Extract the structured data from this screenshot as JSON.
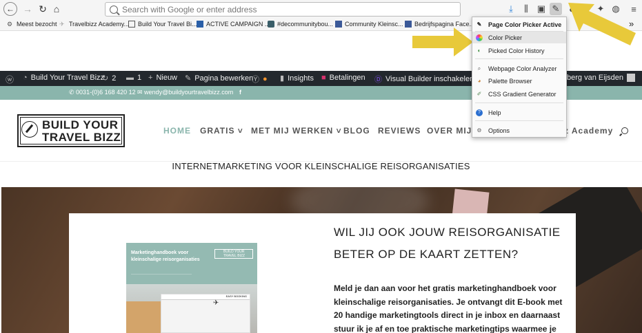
{
  "browser": {
    "url_placeholder": "Search with Google or enter address",
    "bookmarks": [
      "Meest bezocht",
      "Travelbizz Academy...",
      "Build Your Travel Bi...",
      "ACTIVE CAMPAIGN ...",
      "#decommunitybou...",
      "Community Kleinsc...",
      "Bedrijfspagina Face..."
    ]
  },
  "dropdown": {
    "items": [
      "Page Color Picker Active",
      "Color Picker",
      "Picked Color History",
      "Webpage Color Analyzer",
      "Palette Browser",
      "CSS Gradient Generator",
      "Help",
      "Options"
    ]
  },
  "adminbar": {
    "site_name": "Build Your Travel Bizz",
    "updates": "2",
    "comments": "1",
    "new": "Nieuw",
    "edit_page": "Pagina bewerken",
    "insights": "Insights",
    "payments": "Betalingen",
    "visual_builder": "Visual Builder inschakelen",
    "user": "berg van Eijsden"
  },
  "contact": {
    "phone": "0031-(0)6 168 420 12",
    "email": "wendy@buildyourtravelbizz.com",
    "social": "f"
  },
  "header": {
    "logo_line1": "BUILD YOUR",
    "logo_line2": "TRAVEL BIZZ",
    "menu": [
      "HOME",
      "GRATIS",
      "MET MIJ WERKEN",
      "BLOG",
      "REVIEWS",
      "OVER MIJ"
    ],
    "menu_partial": "z Academy"
  },
  "tagline": "INTERNETMARKETING VOOR KLEINSCHALIGE REISORGANISATIES",
  "book": {
    "title": "Marketinghandboek voor kleinschalige reisorganisaties",
    "logo": "BUILD YOUR TRAVEL BIZZ",
    "screen_label": "EASY BOOKING"
  },
  "hero": {
    "heading_line1": "WIL JIJ OOK JOUW REISORGANISATIE",
    "heading_line2": "BETER OP DE KAART ZETTEN?",
    "body_lines": [
      "Meld je dan aan voor het gratis marketinghandboek voor",
      "kleinschalige reisorganisaties. Je ontvangt dit E-book met",
      "20 handige marketingtools direct in je inbox en daarnaast",
      "stuur ik je af en toe praktische marketingtips waarmee je"
    ]
  },
  "colors": {
    "accent": "#8ab5ac",
    "adminbar": "#23282d",
    "arrow": "#e8c93a"
  }
}
